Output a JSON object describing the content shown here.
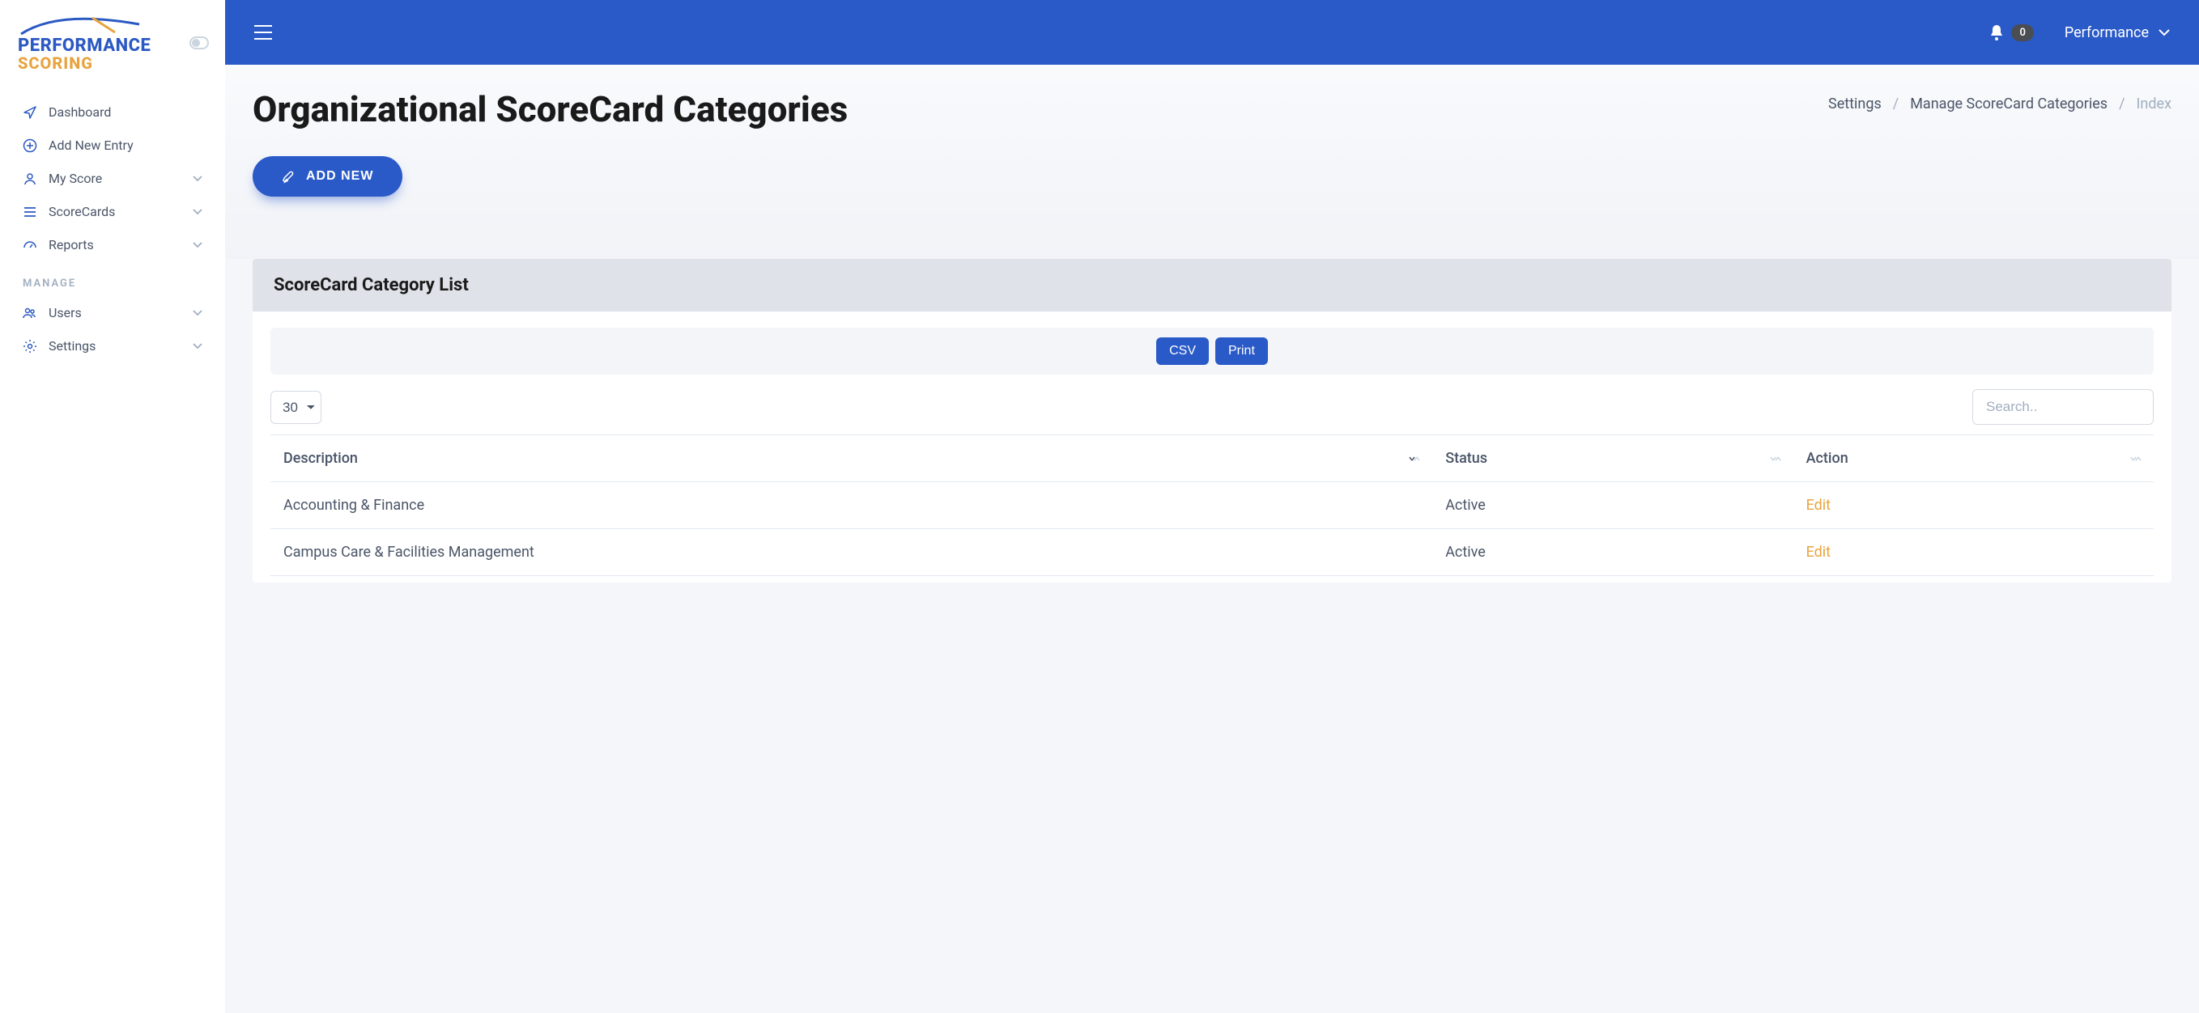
{
  "logo": {
    "line1": "PERFORMANCE",
    "line2": "SCORING"
  },
  "sidebar": {
    "items": [
      {
        "label": "Dashboard",
        "icon": "navigate-icon",
        "expandable": false
      },
      {
        "label": "Add New Entry",
        "icon": "plus-circle-icon",
        "expandable": false
      },
      {
        "label": "My Score",
        "icon": "user-icon",
        "expandable": true
      },
      {
        "label": "ScoreCards",
        "icon": "list-icon",
        "expandable": true
      },
      {
        "label": "Reports",
        "icon": "gauge-icon",
        "expandable": true
      }
    ],
    "section_label": "MANAGE",
    "manage_items": [
      {
        "label": "Users",
        "icon": "users-icon",
        "expandable": true
      },
      {
        "label": "Settings",
        "icon": "gear-icon",
        "expandable": true
      }
    ]
  },
  "topbar": {
    "notifications": "0",
    "user_name": "Performance"
  },
  "header": {
    "title": "Organizational ScoreCard Categories",
    "add_button": "ADD NEW",
    "breadcrumb": {
      "a": "Settings",
      "b": "Manage ScoreCard Categories",
      "c": "Index"
    }
  },
  "list": {
    "title": "ScoreCard Category List",
    "buttons": {
      "csv": "CSV",
      "print": "Print"
    },
    "page_size": "30",
    "search_placeholder": "Search..",
    "columns": {
      "c1": "Description",
      "c2": "Status",
      "c3": "Action"
    },
    "edit_label": "Edit",
    "rows": [
      {
        "description": "Accounting & Finance",
        "status": "Active"
      },
      {
        "description": "Campus Care & Facilities Management",
        "status": "Active"
      }
    ]
  }
}
